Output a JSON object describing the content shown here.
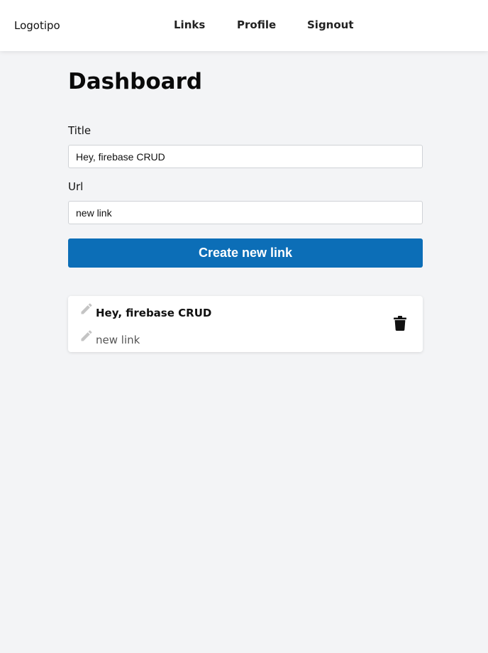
{
  "navbar": {
    "logo": "Logotipo",
    "links": [
      "Links",
      "Profile",
      "Signout"
    ]
  },
  "page": {
    "title": "Dashboard"
  },
  "form": {
    "title_label": "Title",
    "title_value": "Hey, firebase CRUD",
    "url_label": "Url",
    "url_value": "new link",
    "submit_label": "Create new link"
  },
  "links": [
    {
      "title": "Hey, firebase CRUD",
      "url": "new link"
    }
  ],
  "icons": {
    "edit": "pencil-icon",
    "delete": "trash-icon"
  },
  "colors": {
    "primary_button": "#0c6eb7",
    "background": "#f3f4f6",
    "card": "#ffffff",
    "edit_icon": "#c4c4c4"
  }
}
